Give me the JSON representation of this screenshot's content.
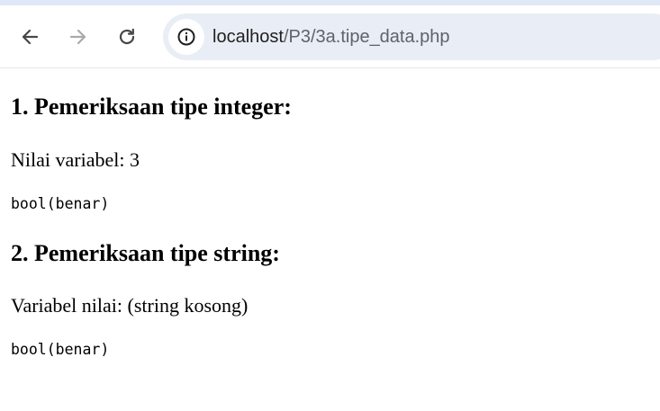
{
  "browser": {
    "url_host": "localhost",
    "url_path": "/P3/3a.tipe_data.php"
  },
  "content": {
    "sections": [
      {
        "heading": "1. Pemeriksaan tipe integer:",
        "value_line": "Nilai variabel: 3",
        "dump": "bool(benar)"
      },
      {
        "heading": "2. Pemeriksaan tipe string:",
        "value_line": "Variabel nilai: (string kosong)",
        "dump": "bool(benar)"
      }
    ]
  },
  "colors": {
    "chrome_background": "#ffffff",
    "omnibox_background": "#e9eef6",
    "icon_color": "#474747",
    "disabled_icon_color": "#a8abad"
  },
  "icons": {
    "back": "arrow-left-icon",
    "forward": "arrow-right-icon",
    "reload": "reload-icon",
    "site_info": "info-icon"
  }
}
